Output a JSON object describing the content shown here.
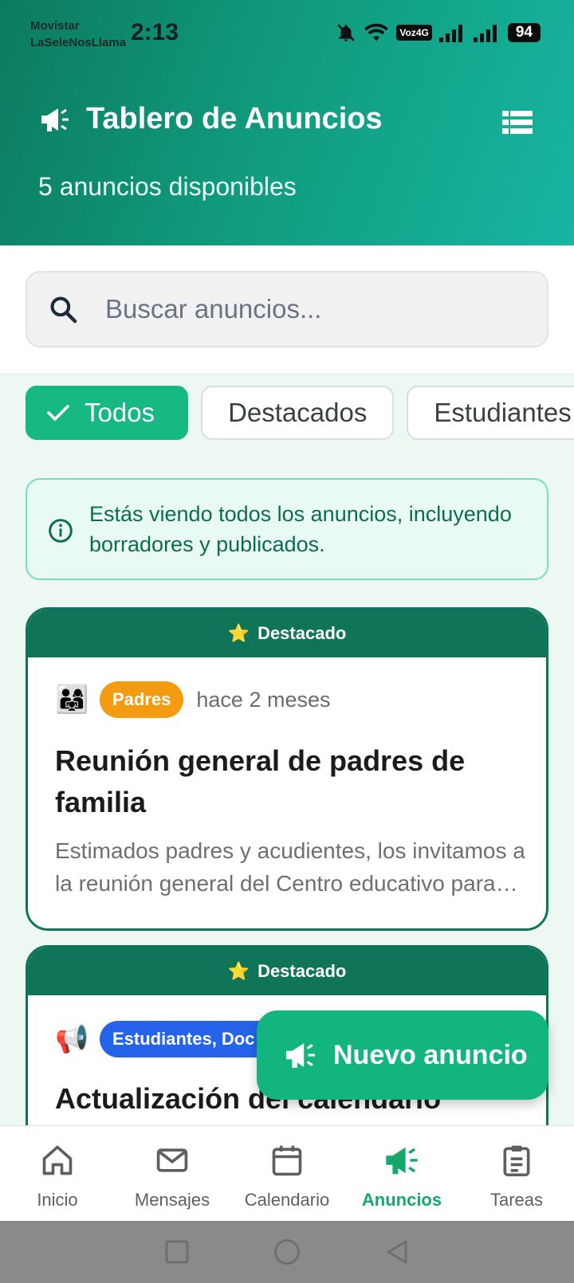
{
  "status_bar": {
    "carrier_line1": "Movistar",
    "carrier_line2": "LaSeleNosLlama",
    "time": "2:13",
    "network_badge": "Voz4G",
    "battery": "94"
  },
  "header": {
    "title": "Tablero de Anuncios",
    "subtitle": "5 anuncios disponibles",
    "title_icon": "megaphone-icon",
    "menu_icon": "list-view-icon"
  },
  "search": {
    "placeholder": "Buscar anuncios...",
    "value": ""
  },
  "filters": [
    {
      "label": "Todos",
      "selected": true
    },
    {
      "label": "Destacados",
      "selected": false
    },
    {
      "label": "Estudiantes",
      "selected": false
    }
  ],
  "info_banner": {
    "text": "Estás viendo todos los anuncios, incluyendo borradores y publicados."
  },
  "announcements": [
    {
      "featured_label": "Destacado",
      "featured_icon": "⭐",
      "audience_icon": "👨‍👩‍👧",
      "audience": "Padres",
      "audience_color": "#f39c12",
      "time": "hace 2 meses",
      "title": "Reunión general de padres de familia",
      "body": "Estimados padres y acudientes, los invitamos a la reunión general del Centro educativo para tratar temas importantes."
    },
    {
      "featured_label": "Destacado",
      "featured_icon": "⭐",
      "audience_icon": "📢",
      "audience": "Estudiantes, Doc",
      "audience_color": "#2563eb",
      "time": "",
      "title": "Actualización del calendario",
      "body": ""
    }
  ],
  "fab": {
    "label": "Nuevo anuncio"
  },
  "bottom_nav": [
    {
      "label": "Inicio",
      "icon": "home-icon",
      "active": false
    },
    {
      "label": "Mensajes",
      "icon": "mail-icon",
      "active": false
    },
    {
      "label": "Calendario",
      "icon": "calendar-icon",
      "active": false
    },
    {
      "label": "Anuncios",
      "icon": "megaphone-icon",
      "active": true
    },
    {
      "label": "Tareas",
      "icon": "clipboard-icon",
      "active": false
    }
  ],
  "colors": {
    "header_start": "#0c7a5f",
    "header_end": "#17b6a2",
    "accent": "#16b981",
    "featured": "#0f7458",
    "active_nav": "#14a86f"
  }
}
